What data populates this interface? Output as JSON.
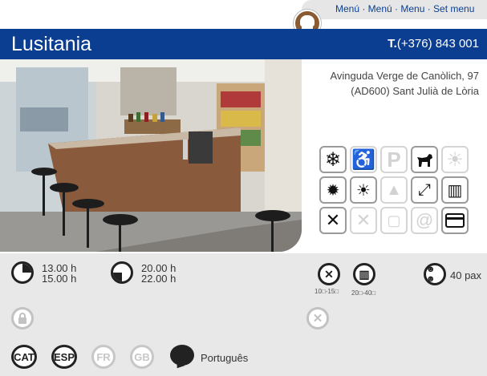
{
  "menu_bar": {
    "label": "Menú · Menú · Menu · Set menu",
    "icon": "chef-hat-icon"
  },
  "header": {
    "name": "Lusitania",
    "phone_prefix": "T.",
    "phone": "(+376) 843 001"
  },
  "address": {
    "line1": "Avinguda Verge de Canòlich, 97",
    "line2": "(AD600) Sant Julià de Lòria"
  },
  "amenities": [
    {
      "name": "air-conditioning-icon",
      "active": true
    },
    {
      "name": "wheelchair-access-icon",
      "active": false
    },
    {
      "name": "parking-icon",
      "active": false
    },
    {
      "name": "pets-allowed-icon",
      "active": true
    },
    {
      "name": "terrace-sun-icon",
      "active": false
    },
    {
      "name": "heating-icon",
      "active": true
    },
    {
      "name": "sunny-terrace-icon",
      "active": true
    },
    {
      "name": "mountain-view-icon",
      "active": false
    },
    {
      "name": "fullscreen-view-icon",
      "active": true
    },
    {
      "name": "book-menu-icon",
      "active": true
    },
    {
      "name": "cutlery-icon",
      "active": true
    },
    {
      "name": "gluten-free-icon",
      "active": false
    },
    {
      "name": "wine-bucket-icon",
      "active": false
    },
    {
      "name": "internet-icon",
      "active": false
    },
    {
      "name": "credit-card-icon",
      "active": true
    }
  ],
  "schedule": {
    "lunch": {
      "open": "13.00 h",
      "close": "15.00 h"
    },
    "dinner": {
      "open": "20.00 h",
      "close": "22.00 h"
    }
  },
  "prices": {
    "menu_price": "10□-15□",
    "carte_price": "20□-40□",
    "capacity": "40 pax"
  },
  "languages": [
    {
      "code": "CAT",
      "active": true
    },
    {
      "code": "ESP",
      "active": true
    },
    {
      "code": "FR",
      "active": false
    },
    {
      "code": "GB",
      "active": false
    }
  ],
  "other_language": "Português"
}
